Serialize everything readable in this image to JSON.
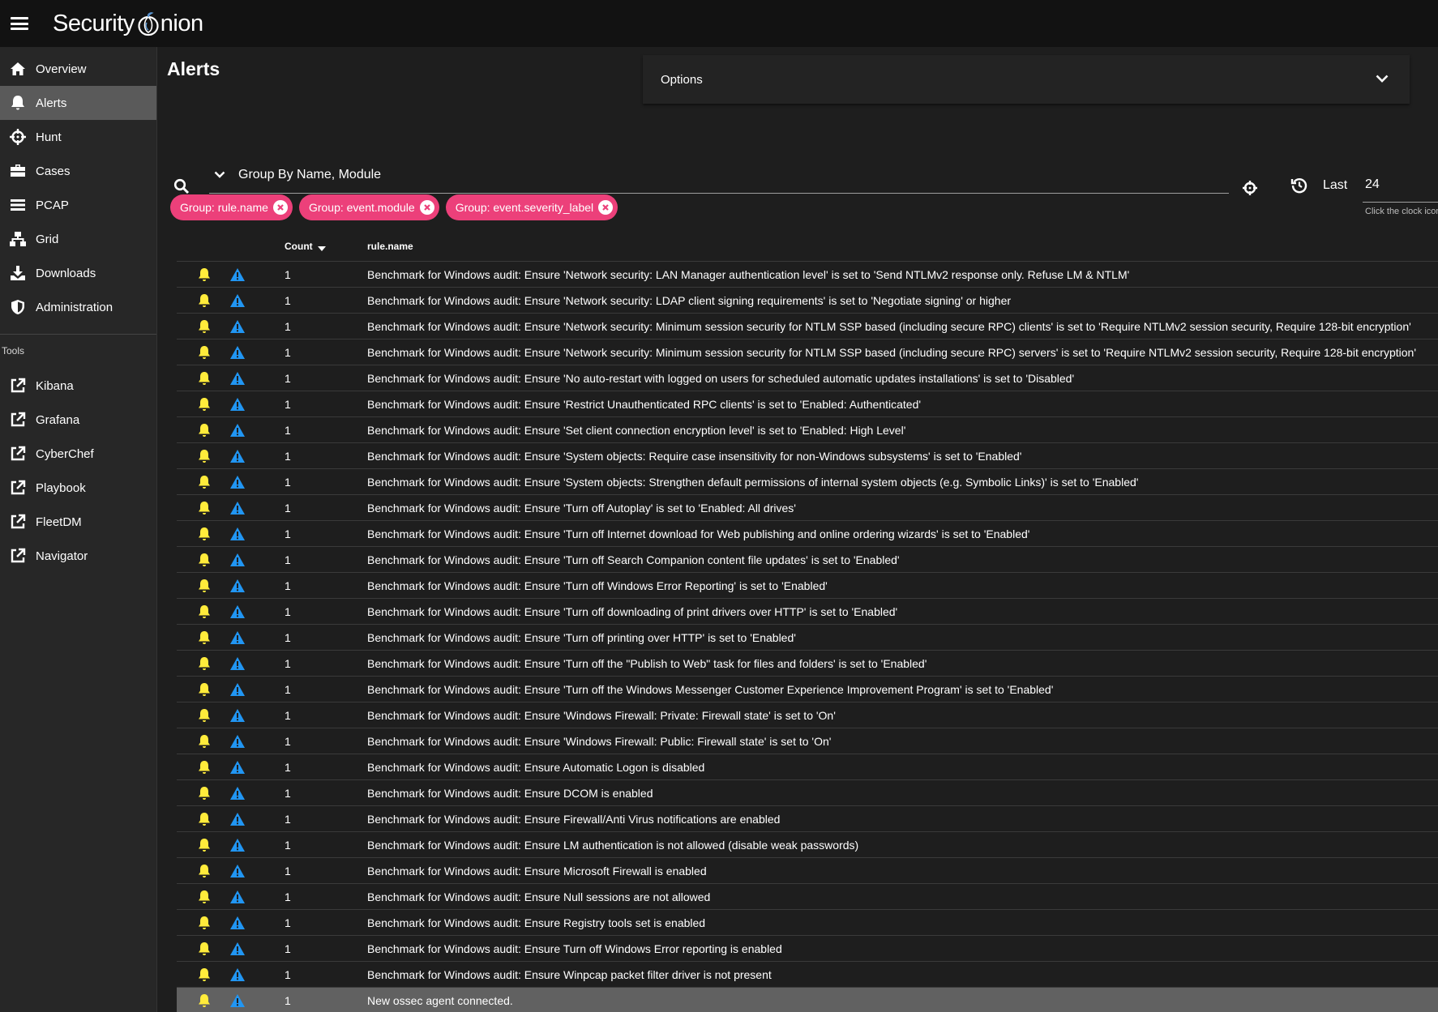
{
  "app": {
    "title_part1": "Security",
    "title_part2": "nion"
  },
  "sidebar": {
    "items": [
      {
        "label": "Overview",
        "icon": "home-icon"
      },
      {
        "label": "Alerts",
        "icon": "bell-icon",
        "active": true
      },
      {
        "label": "Hunt",
        "icon": "crosshair-icon"
      },
      {
        "label": "Cases",
        "icon": "briefcase-icon"
      },
      {
        "label": "PCAP",
        "icon": "list-icon"
      },
      {
        "label": "Grid",
        "icon": "sitemap-icon"
      },
      {
        "label": "Downloads",
        "icon": "download-icon"
      },
      {
        "label": "Administration",
        "icon": "shield-icon"
      }
    ],
    "tools_label": "Tools",
    "tools": [
      {
        "label": "Kibana",
        "icon": "external-link-icon"
      },
      {
        "label": "Grafana",
        "icon": "external-link-icon"
      },
      {
        "label": "CyberChef",
        "icon": "external-link-icon"
      },
      {
        "label": "Playbook",
        "icon": "external-link-icon"
      },
      {
        "label": "FleetDM",
        "icon": "external-link-icon"
      },
      {
        "label": "Navigator",
        "icon": "external-link-icon"
      }
    ]
  },
  "main": {
    "title": "Alerts",
    "options_label": "Options",
    "query": "Group By Name, Module",
    "last_label": "Last",
    "last_value": "24",
    "hint": "Click the clock icon",
    "chips": [
      "Group: rule.name",
      "Group: event.module",
      "Group: event.severity_label"
    ],
    "table": {
      "col_count": "Count",
      "col_name": "rule.name",
      "rows": [
        {
          "count": "1",
          "name": "Benchmark for Windows audit: Ensure 'Network security: LAN Manager authentication level' is set to 'Send NTLMv2 response only. Refuse LM & NTLM'"
        },
        {
          "count": "1",
          "name": "Benchmark for Windows audit: Ensure 'Network security: LDAP client signing requirements' is set to 'Negotiate signing' or higher"
        },
        {
          "count": "1",
          "name": "Benchmark for Windows audit: Ensure 'Network security: Minimum session security for NTLM SSP based (including secure RPC) clients' is set to 'Require NTLMv2 session security, Require 128-bit encryption'"
        },
        {
          "count": "1",
          "name": "Benchmark for Windows audit: Ensure 'Network security: Minimum session security for NTLM SSP based (including secure RPC) servers' is set to 'Require NTLMv2 session security, Require 128-bit encryption'"
        },
        {
          "count": "1",
          "name": "Benchmark for Windows audit: Ensure 'No auto-restart with logged on users for scheduled automatic updates installations' is set to 'Disabled'"
        },
        {
          "count": "1",
          "name": "Benchmark for Windows audit: Ensure 'Restrict Unauthenticated RPC clients' is set to 'Enabled: Authenticated'"
        },
        {
          "count": "1",
          "name": "Benchmark for Windows audit: Ensure 'Set client connection encryption level' is set to 'Enabled: High Level'"
        },
        {
          "count": "1",
          "name": "Benchmark for Windows audit: Ensure 'System objects: Require case insensitivity for non-Windows subsystems' is set to 'Enabled'"
        },
        {
          "count": "1",
          "name": "Benchmark for Windows audit: Ensure 'System objects: Strengthen default permissions of internal system objects (e.g. Symbolic Links)' is set to 'Enabled'"
        },
        {
          "count": "1",
          "name": "Benchmark for Windows audit: Ensure 'Turn off Autoplay' is set to 'Enabled: All drives'"
        },
        {
          "count": "1",
          "name": "Benchmark for Windows audit: Ensure 'Turn off Internet download for Web publishing and online ordering wizards' is set to 'Enabled'"
        },
        {
          "count": "1",
          "name": "Benchmark for Windows audit: Ensure 'Turn off Search Companion content file updates' is set to 'Enabled'"
        },
        {
          "count": "1",
          "name": "Benchmark for Windows audit: Ensure 'Turn off Windows Error Reporting' is set to 'Enabled'"
        },
        {
          "count": "1",
          "name": "Benchmark for Windows audit: Ensure 'Turn off downloading of print drivers over HTTP' is set to 'Enabled'"
        },
        {
          "count": "1",
          "name": "Benchmark for Windows audit: Ensure 'Turn off printing over HTTP' is set to 'Enabled'"
        },
        {
          "count": "1",
          "name": "Benchmark for Windows audit: Ensure 'Turn off the \"Publish to Web\" task for files and folders' is set to 'Enabled'"
        },
        {
          "count": "1",
          "name": "Benchmark for Windows audit: Ensure 'Turn off the Windows Messenger Customer Experience Improvement Program' is set to 'Enabled'"
        },
        {
          "count": "1",
          "name": "Benchmark for Windows audit: Ensure 'Windows Firewall: Private: Firewall state' is set to 'On'"
        },
        {
          "count": "1",
          "name": "Benchmark for Windows audit: Ensure 'Windows Firewall: Public: Firewall state' is set to 'On'"
        },
        {
          "count": "1",
          "name": "Benchmark for Windows audit: Ensure Automatic Logon is disabled"
        },
        {
          "count": "1",
          "name": "Benchmark for Windows audit: Ensure DCOM is enabled"
        },
        {
          "count": "1",
          "name": "Benchmark for Windows audit: Ensure Firewall/Anti Virus notifications are enabled"
        },
        {
          "count": "1",
          "name": "Benchmark for Windows audit: Ensure LM authentication is not allowed (disable weak passwords)"
        },
        {
          "count": "1",
          "name": "Benchmark for Windows audit: Ensure Microsoft Firewall is enabled"
        },
        {
          "count": "1",
          "name": "Benchmark for Windows audit: Ensure Null sessions are not allowed"
        },
        {
          "count": "1",
          "name": "Benchmark for Windows audit: Ensure Registry tools set is enabled"
        },
        {
          "count": "1",
          "name": "Benchmark for Windows audit: Ensure Turn off Windows Error reporting is enabled"
        },
        {
          "count": "1",
          "name": "Benchmark for Windows audit: Ensure Winpcap packet filter driver is not present"
        },
        {
          "count": "1",
          "name": "New ossec agent connected.",
          "selected": true
        }
      ]
    }
  },
  "colors": {
    "bell": "#ffeb3b",
    "warning": "#2196f3",
    "chip": "#ec407a",
    "active_nav": "#5a5a5a"
  }
}
